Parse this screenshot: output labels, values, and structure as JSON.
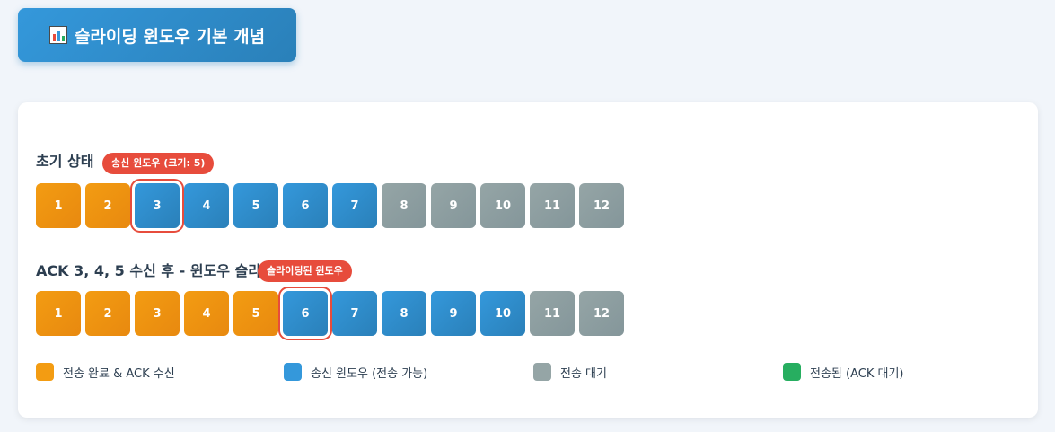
{
  "header": {
    "title": "슬라이딩 윈도우 기본 개념",
    "icon": "bar-chart-icon"
  },
  "initial": {
    "label": "초기 상태",
    "tag": "송신 윈도우 (크기: 5)",
    "cells": [
      {
        "num": "1",
        "state": "done"
      },
      {
        "num": "2",
        "state": "done"
      },
      {
        "num": "3",
        "state": "window",
        "marked": true
      },
      {
        "num": "4",
        "state": "window"
      },
      {
        "num": "5",
        "state": "window"
      },
      {
        "num": "6",
        "state": "window"
      },
      {
        "num": "7",
        "state": "window"
      },
      {
        "num": "8",
        "state": "wait"
      },
      {
        "num": "9",
        "state": "wait"
      },
      {
        "num": "10",
        "state": "wait"
      },
      {
        "num": "11",
        "state": "wait"
      },
      {
        "num": "12",
        "state": "wait"
      }
    ]
  },
  "after": {
    "label": "ACK 3, 4, 5 수신 후 - 윈도우 슬라",
    "tag": "슬라이딩된 윈도우",
    "cells": [
      {
        "num": "1",
        "state": "done"
      },
      {
        "num": "2",
        "state": "done"
      },
      {
        "num": "3",
        "state": "done"
      },
      {
        "num": "4",
        "state": "done"
      },
      {
        "num": "5",
        "state": "done"
      },
      {
        "num": "6",
        "state": "window",
        "marked": true
      },
      {
        "num": "7",
        "state": "window"
      },
      {
        "num": "8",
        "state": "window"
      },
      {
        "num": "9",
        "state": "window"
      },
      {
        "num": "10",
        "state": "window"
      },
      {
        "num": "11",
        "state": "wait"
      },
      {
        "num": "12",
        "state": "wait"
      }
    ]
  },
  "legend": [
    {
      "label": "전송 완료 & ACK 수신",
      "color": "#f39c12"
    },
    {
      "label": "송신 윈도우 (전송 가능)",
      "color": "#3498db"
    },
    {
      "label": "전송 대기",
      "color": "#95a5a6"
    },
    {
      "label": "전송됨 (ACK 대기)",
      "color": "#27ae60"
    }
  ],
  "colors": {
    "done": "#f39c12",
    "window": "#3498db",
    "wait": "#95a5a6",
    "sent": "#27ae60",
    "marker": "#e74c3c"
  }
}
